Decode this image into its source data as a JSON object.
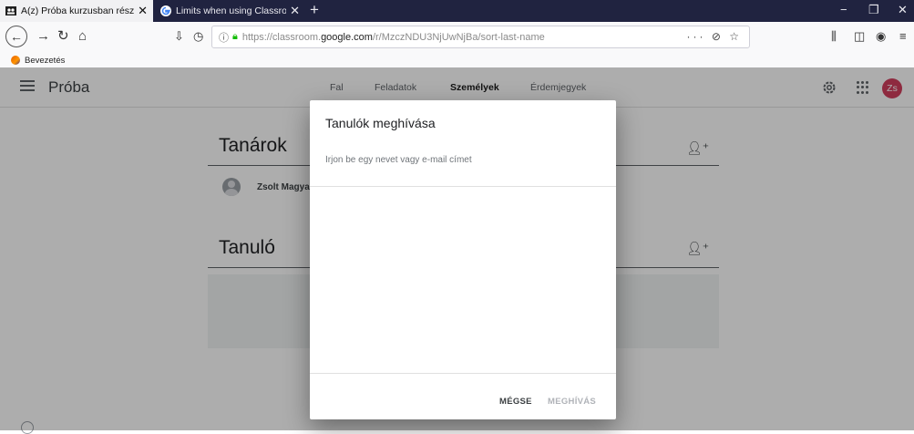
{
  "browser": {
    "tabs": [
      {
        "title": "A(z) Próba kurzusban részt vevő",
        "active": true
      },
      {
        "title": "Limits when using Classroom -",
        "active": false
      }
    ],
    "tab_close": "✕",
    "new_tab": "+",
    "window_controls": {
      "minimize": "−",
      "maximize": "❐",
      "close": "✕"
    },
    "url": {
      "prefix": "https://classroom.",
      "domain": "google.com",
      "path": "/r/MzczNDU3NjUwNjBa/sort-last-name"
    },
    "url_actions": "··· ⊘ ☆",
    "bookmark": "Bevezetés"
  },
  "classroom": {
    "class_name": "Próba",
    "tabs": [
      "Fal",
      "Feladatok",
      "Személyek",
      "Érdemjegyek"
    ],
    "selected_tab": "Személyek",
    "avatar_initials": "Zs",
    "accent_color": "#d23f5e",
    "teachers": {
      "title": "Tanárok",
      "items": [
        "Zsolt Magya"
      ]
    },
    "students": {
      "title": "Tanuló"
    }
  },
  "dialog": {
    "title": "Tanulók meghívása",
    "input_placeholder": "Írjon be egy nevet vagy e-mail címet",
    "cancel_label": "MÉGSE",
    "invite_label": "MEGHÍVÁS"
  }
}
